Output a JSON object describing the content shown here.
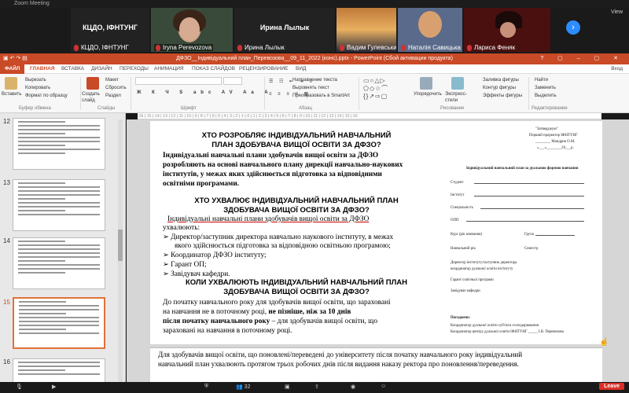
{
  "zoom": {
    "window_title": "Zoom Meeting",
    "view_label": "View",
    "participants": [
      {
        "big_label": "КЦДО, ІФНТУНГ",
        "name": "КЦДО, ІФНТУНГ"
      },
      {
        "big_label": "",
        "name": "Iryna Perevozova"
      },
      {
        "big_label": "Ирина Лылык",
        "name": "Ирина Лылык"
      },
      {
        "big_label": "",
        "name": "Вадим Гулевський"
      },
      {
        "big_label": "",
        "name": "Наталія Савицька"
      },
      {
        "big_label": "",
        "name": "Лариса Феняк"
      }
    ],
    "next_icon": "›",
    "bottom_count": "32",
    "leave_label": "Leave"
  },
  "ppt": {
    "title": "ДФЗО__Індивідуальний план_Перевозова__09_11_2022 (конс).pptx - PowerPoint (Сбой активации продукта)",
    "tabs": [
      "ФАЙЛ",
      "ГЛАВНАЯ",
      "ВСТАВКА",
      "ДИЗАЙН",
      "ПЕРЕХОДЫ",
      "АНИМАЦИЯ",
      "ПОКАЗ СЛАЙДОВ",
      "РЕЦЕНЗИРОВАНИЕ",
      "ВИД"
    ],
    "login": "Вход",
    "ribbon": {
      "paste": "Вставить",
      "cut": "Вырезать",
      "copy": "Копировать",
      "format_painter": "Формат по образцу",
      "clipboard_group": "Буфер обмена",
      "create_slide": "Создать слайд",
      "layout": "Макет",
      "reset": "Сбросить",
      "section": "Раздел",
      "slides_group": "Слайды",
      "font_group": "Шрифт",
      "paragraph_group": "Абзац",
      "text_direction": "Направление текста",
      "align_text": "Выровнять текст",
      "smartart": "Преобразовать в SmartArt",
      "arrange": "Упорядочить",
      "quick_styles": "Экспресс-стили",
      "drawing_group": "Рисование",
      "fill": "Заливка фигуры",
      "outline": "Контур фигуры",
      "effects": "Эффекты фигуры",
      "find": "Найти",
      "replace": "Заменить",
      "select": "Выделить",
      "editing_group": "Редактирование"
    },
    "thumb_numbers": [
      "12",
      "13",
      "14",
      "15",
      "16"
    ]
  },
  "slide": {
    "h1a": "ХТО РОЗРОБЛЯЄ ІНДИВІДУАЛЬНИЙ НАВЧАЛЬНИЙ",
    "h1b": "ПЛАН ЗДОБУВАЧА ВИЩОЇ ОСВІТИ ЗА ДФЗО?",
    "p1_l1": "Індивідуальні навчальні плани здобувачів вищої освіти за ДФЗО",
    "p1_l2": "розробляють на основі навчального плану дирекції навчально-наукових",
    "p1_l3": "інститутів, у межах яких здійснюється підготовка за відповідними",
    "p1_l4": "освітніми програмами.",
    "h2a": "ХТО УХВАЛЮЄ ІНДИВІДУАЛЬНИЙ НАВЧАЛЬНИЙ ПЛАН",
    "h2b": "ЗДОБУВАЧА ВИЩОЇ ОСВІТИ ЗА ДФЗО?",
    "p2_l1": "Індивідуальні навчальні плани здобувачів вищої освіти за ДФЗО",
    "p2_l2": "ухвалюють:",
    "bullets": [
      "Директор/заступник директора навчально наукового інституту, в межах",
      "якого здійснюється підготовка за відповідною освітньою програмою;",
      "Координатор ДФЗО інституту;",
      "Гарант ОП;",
      "Завідувач кафедри."
    ],
    "h3a": "КОЛИ УХВАЛЮЮТЬ ІНДИВІДУАЛЬНИЙ НАВЧАЛЬНИЙ ПЛАН",
    "h3b": "ЗДОБУВАЧА ВИЩОЇ ОСВІТИ ЗА ДФЗО?",
    "p3_l1": "До початку навчального року для здобувачів вищої освіти, що зараховані",
    "p3_l2a": "на навчання не в поточному році,",
    "p3_l2b": " не пізніше, ніж за 10 днів",
    "p3_l3a": "після початку навчального року",
    "p3_l3b": " – для здобувачів вищої освіти, що",
    "p3_l4": "зараховані на навчання в поточному році."
  },
  "doc": {
    "approve": "\"Затверджую\"",
    "prorector": "Перший проректор ІФНТУНГ",
    "sign": "________ Мандрик О.М.",
    "date": "«___»________20___р.",
    "title": "Індивідуальний навчальний план за дуальною формою навчання",
    "fields": [
      "Студент",
      "Інститут",
      "Спеціальність",
      "ОПП",
      "Курс (рік навчання)",
      "Навчальний рік",
      "Директор інституту/заступник директора",
      "координатор дуальної освіти інституту",
      "Гарант освітньої програми",
      "Завідувач кафедри"
    ],
    "group": "Група",
    "semester": "Семестр",
    "agreed": "Погоджено:",
    "agreed1": "Координатор дуальної освіти суб'єкта господарювання",
    "agreed2": "Координатор центру дуальної освіти ІФНТУНГ",
    "agreed2_sign": "І.В. Перевозова"
  },
  "notes": {
    "l1": "Для здобувачів вищої освіти, що поновлені/переведені до університету після початку навчального року індивідуальний",
    "l2": "навчальний план ухвалюють протягом трьох робочих днів після видання наказу ректора про поновлення/переведення."
  }
}
